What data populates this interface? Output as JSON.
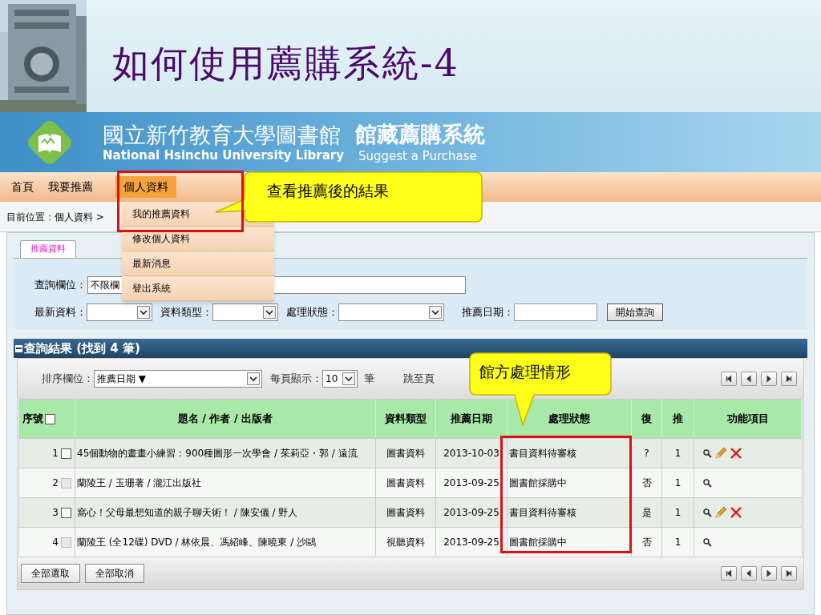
{
  "slide": {
    "title": "如何使用薦購系統-4"
  },
  "header": {
    "library_zh": "國立新竹教育大學圖書館",
    "library_en": "National Hsinchu University Library",
    "system_zh": "館藏薦購系統",
    "system_en": "Suggest a Purchase"
  },
  "nav": [
    {
      "label": "首頁",
      "selected": false
    },
    {
      "label": "我要推薦",
      "selected": false
    },
    {
      "label": "個人資料",
      "selected": true
    }
  ],
  "dropdown": [
    "我的推薦資料",
    "修改個人資料",
    "最新消息",
    "登出系統"
  ],
  "breadcrumb": "目前位置：個人資料 >",
  "callouts": [
    "查看推薦後的結果",
    "館方處理情形"
  ],
  "search_panel": {
    "tab": {
      "label": "推薦資料",
      "selected": true
    },
    "field_label": "查詢欄位：",
    "field_value": "不限欄",
    "filters": [
      {
        "label": "最新資料：",
        "kind": "select"
      },
      {
        "label": "資料類型：",
        "kind": "select"
      },
      {
        "label": "處理狀態：",
        "kind": "select"
      },
      {
        "label": "推薦日期：",
        "kind": "input"
      }
    ],
    "button": "開始查詢"
  },
  "results": {
    "title": "查詢結果 (找到 4 筆)",
    "sort_label": "排序欄位：",
    "sort_value": "推薦日期 ▼",
    "per_page_label": "每頁顯示：",
    "per_page_value": "10",
    "per_page_unit": "筆",
    "jump_label": "跳至頁",
    "select_all_checked": false,
    "columns": [
      "序號",
      "題名 / 作者 / 出版者",
      "資料類型",
      "推薦日期",
      "處理狀態",
      "復",
      "推",
      "功能項目"
    ],
    "rows": [
      {
        "no": "1",
        "checked": false,
        "disabled": false,
        "title": "45個動物的畫畫小練習：900種圖形一次學會 / 茱莉亞・郭 / 遠流",
        "type": "圖書資料",
        "date": "2013-10-03",
        "status": "書目資料待審核",
        "col_6": "?",
        "col_7": "1",
        "editable": true
      },
      {
        "no": "2",
        "checked": false,
        "disabled": true,
        "title": "蘭陵王 / 玉珊著 / 瀧江出版社",
        "type": "圖書資料",
        "date": "2013-09-25",
        "status": "圖書館採購中",
        "col_6": "否",
        "col_7": "1",
        "editable": false
      },
      {
        "no": "3",
        "checked": false,
        "disabled": false,
        "title": "窩心！父母最想知道的親子聊天術！ / 陳安儀 / 野人",
        "type": "圖書資料",
        "date": "2013-09-25",
        "status": "書目資料待審核",
        "col_6": "是",
        "col_7": "1",
        "editable": true
      },
      {
        "no": "4",
        "checked": false,
        "disabled": true,
        "title": "蘭陵王 (全12碟) DVD / 林依晨、馮紹峰、陳曉東 / 沙鷗",
        "type": "視聽資料",
        "date": "2013-09-25",
        "status": "圖書館採購中",
        "col_6": "否",
        "col_7": "1",
        "editable": false
      }
    ],
    "footer_buttons": [
      "全部選取",
      "全部取消"
    ]
  }
}
